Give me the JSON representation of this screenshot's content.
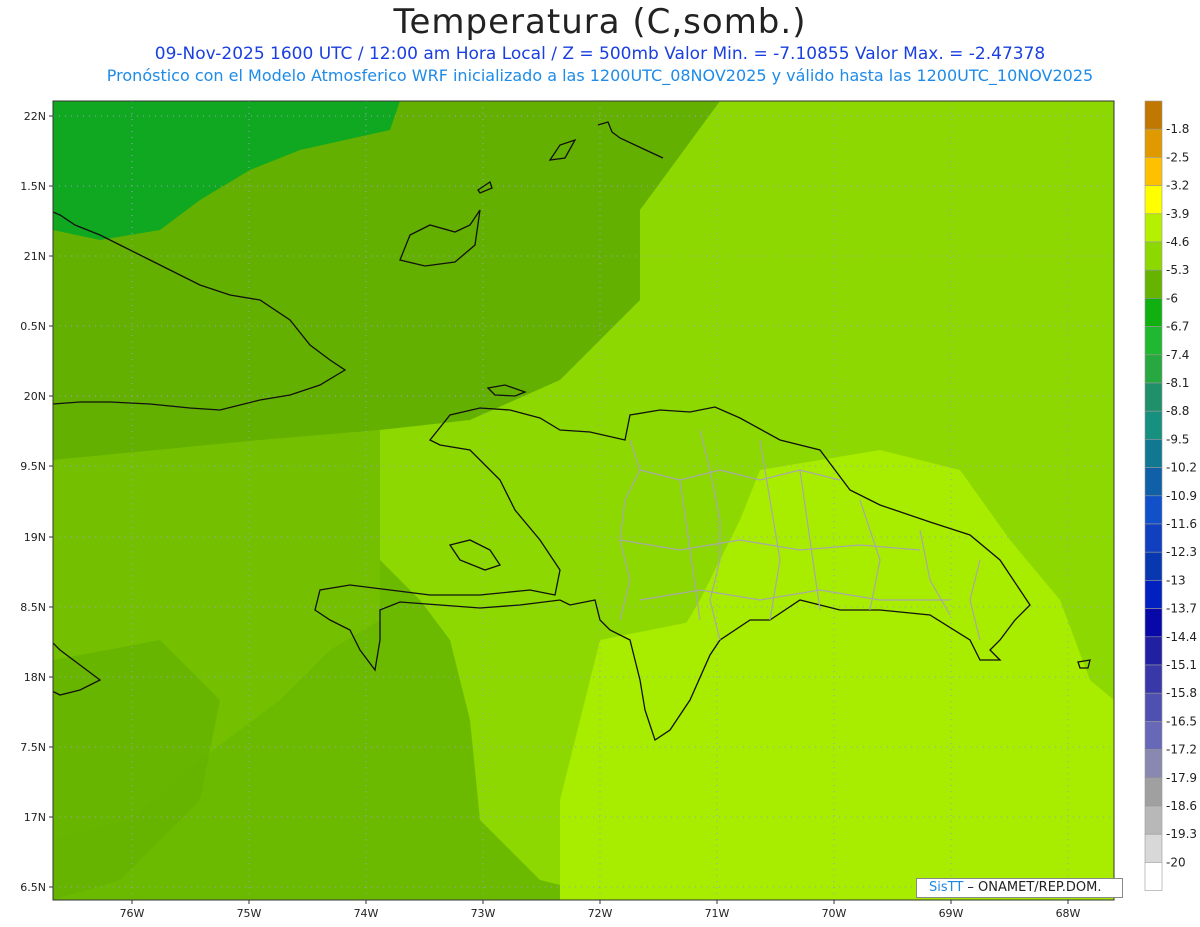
{
  "header": {
    "title": "Temperatura (C,somb.)",
    "line1": "09-Nov-2025 1600 UTC / 12:00 am Hora Local / Z = 500mb  Valor Min. = -7.10855  Valor Max. = -2.47378",
    "line2": "Pronóstico con el Modelo Atmosferico WRF inicializado a las 1200UTC_08NOV2025 y válido hasta las  1200UTC_10NOV2025"
  },
  "axes": {
    "lat_labels": [
      "22N",
      "1.5N",
      "21N",
      "0.5N",
      "20N",
      "9.5N",
      "19N",
      "8.5N",
      "18N",
      "7.5N",
      "17N",
      "6.5N"
    ],
    "lon_labels": [
      "76W",
      "75W",
      "74W",
      "73W",
      "72W",
      "71W",
      "70W",
      "69W",
      "68W"
    ]
  },
  "colorbar": {
    "labels": [
      "-1.8",
      "-2.5",
      "-3.2",
      "-3.9",
      "-4.6",
      "-5.3",
      "-6",
      "-6.7",
      "-7.4",
      "-8.1",
      "-8.8",
      "-9.5",
      "-10.2",
      "-10.9",
      "-11.6",
      "-12.3",
      "-13",
      "-13.7",
      "-14.4",
      "-15.1",
      "-15.8",
      "-16.5",
      "-17.2",
      "-17.9",
      "-18.6",
      "-19.3",
      "-20"
    ],
    "colors": [
      "#c07800",
      "#e09a00",
      "#ffc000",
      "#ffff00",
      "#b4f000",
      "#8cd800",
      "#64b400",
      "#10b010",
      "#20b830",
      "#28a840",
      "#20906a",
      "#189080",
      "#107890",
      "#1060a8",
      "#1050c8",
      "#1040c0",
      "#0838b0",
      "#0020c0",
      "#0808a8",
      "#2020a0",
      "#3838a8",
      "#5050b0",
      "#6868b8",
      "#8888b0",
      "#a0a0a0",
      "#b8b8b8",
      "#d8d8d8",
      "#ffffff"
    ]
  },
  "credit": {
    "brand": "SisTT",
    "org": " – ONAMET/REP.DOM."
  }
}
